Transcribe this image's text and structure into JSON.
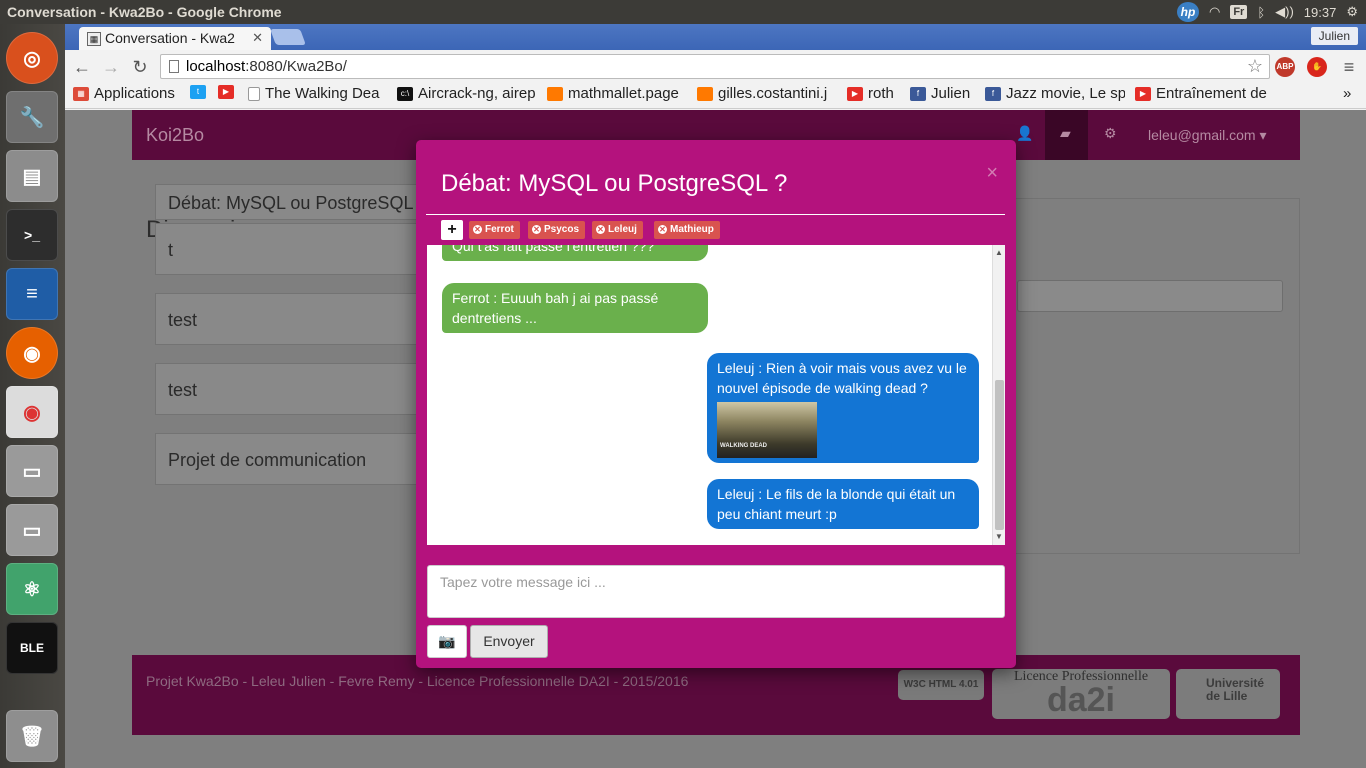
{
  "os": {
    "window_title": "Conversation - Kwa2Bo - Google Chrome",
    "keyboard_layout": "Fr",
    "clock": "19:37"
  },
  "browser": {
    "tab_title": "Conversation - Kwa2",
    "profile_name": "Julien",
    "url_host": "localhost",
    "url_rest": ":8080/Kwa2Bo/",
    "ext_abp": "ABP",
    "bookmarks": [
      {
        "label": "Applications"
      },
      {
        "label": ""
      },
      {
        "label": ""
      },
      {
        "label": "The Walking Dea"
      },
      {
        "label": "Aircrack-ng, airep"
      },
      {
        "label": "mathmallet.page"
      },
      {
        "label": "gilles.costantini.j"
      },
      {
        "label": "roth"
      },
      {
        "label": "Julien"
      },
      {
        "label": "Jazz movie, Le sp"
      },
      {
        "label": "Entraînement de"
      }
    ],
    "bookmarks_overflow": "»"
  },
  "site": {
    "brand": "Koi2Bo",
    "user_email": "leleu@gmail.com",
    "discussions_heading": "Discussions",
    "discussions": [
      "Débat: MySQL ou PostgreSQL",
      "t",
      "test",
      "test",
      "Projet de communication"
    ],
    "footer_credits": "Projet Kwa2Bo - Leleu Julien - Fevre Remy - Licence Professionnelle DA2I - 2015/2016",
    "w3c_badge": "W3C HTML 4.01",
    "da2i_logo_top": "Licence Professionnelle",
    "da2i_logo_main": "da2i",
    "univ_logo": "Université de Lille"
  },
  "modal": {
    "title": "Débat: MySQL ou PostgreSQL ?",
    "close": "×",
    "add_participant": "+",
    "participants": [
      "Ferrot",
      "Psycos",
      "Leleuj",
      "Mathieup"
    ],
    "messages": [
      {
        "text": "Qui t'as fait passé l'entretien ???"
      },
      {
        "text": "Ferrot : Euuuh bah j ai pas passé dentretiens ..."
      },
      {
        "text": "Leleuj : Rien à voir mais vous avez vu le nouvel épisode de walking dead ?",
        "image_caption": "WALKING DEAD"
      },
      {
        "text": "Leleuj : Le fils de la blonde qui était un peu chiant meurt :p"
      }
    ],
    "input_placeholder": "Tapez votre message ici ...",
    "send_label": "Envoyer"
  }
}
